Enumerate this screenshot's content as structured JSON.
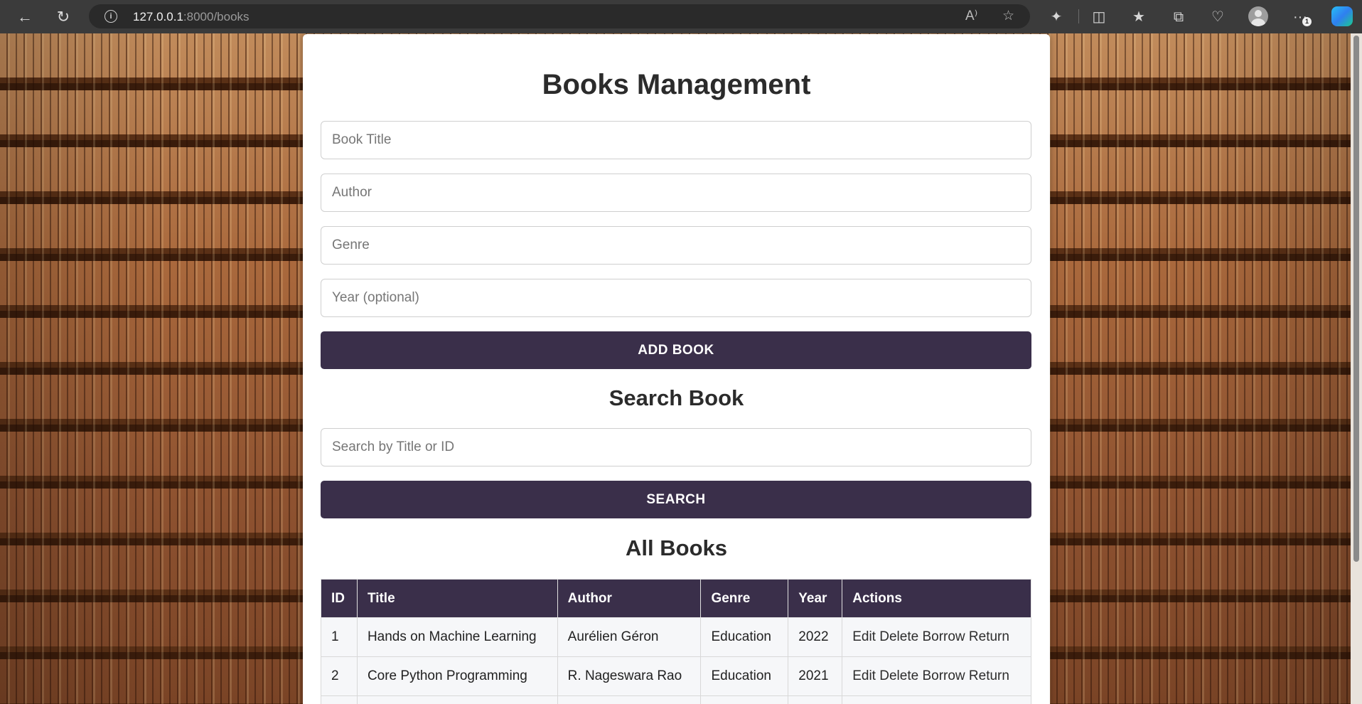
{
  "browser": {
    "url_host": "127.0.0.1",
    "url_path": ":8000/books",
    "notification_count": "1"
  },
  "page": {
    "title": "Books Management",
    "add_form": {
      "title_placeholder": "Book Title",
      "author_placeholder": "Author",
      "genre_placeholder": "Genre",
      "year_placeholder": "Year (optional)",
      "submit_label": "Add Book"
    },
    "search": {
      "heading": "Search Book",
      "placeholder": "Search by Title or ID",
      "button_label": "Search"
    },
    "list": {
      "heading": "All Books",
      "columns": [
        "ID",
        "Title",
        "Author",
        "Genre",
        "Year",
        "Actions"
      ],
      "rows": [
        {
          "id": "1",
          "title": "Hands on Machine Learning",
          "author": "Aurélien Géron",
          "genre": "Education",
          "year": "2022"
        },
        {
          "id": "2",
          "title": "Core Python Programming",
          "author": "R. Nageswara Rao",
          "genre": "Education",
          "year": "2021"
        }
      ],
      "actions": {
        "edit": "Edit",
        "delete": "Delete",
        "borrow": "Borrow",
        "return": "Return"
      }
    }
  },
  "colors": {
    "primary": "#3a2f4a",
    "panel_bg": "#ffffff",
    "cell_bg": "#f6f7f9"
  }
}
